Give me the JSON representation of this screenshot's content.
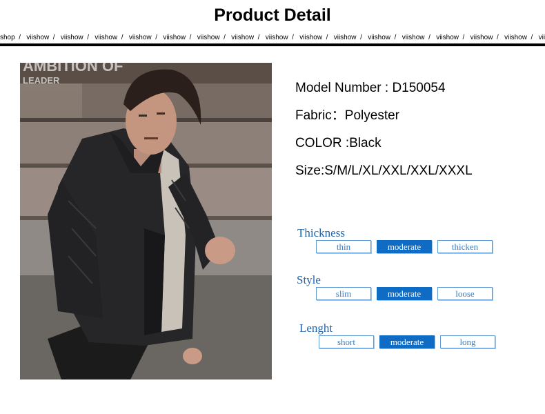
{
  "header": {
    "title": "Product Detail",
    "marquee": [
      "shop",
      "viishow",
      "viishow",
      "viishow",
      "viishow",
      "viishow",
      "viishow",
      "viishow",
      "viishow",
      "viishow",
      "viishow",
      "viishow",
      "viishow",
      "viishow",
      "viishow",
      "viishow",
      "viis"
    ],
    "separator": "/"
  },
  "photo": {
    "sign_text_top": "AMBITION OF",
    "sign_text_bottom": "LEADER"
  },
  "specs": [
    {
      "text": "Model Number : D150054"
    },
    {
      "text": "Fabric：Polyester"
    },
    {
      "text": "COLOR :Black"
    },
    {
      "text": "Size:S/M/L/XL/XXL/XXL/XXXL"
    }
  ],
  "options": [
    {
      "title": "Thickness",
      "items": [
        "thin",
        "moderate",
        "thicken"
      ],
      "selected": 1
    },
    {
      "title": "Style",
      "items": [
        "slim",
        "moderate",
        "loose"
      ],
      "selected": 1
    },
    {
      "title": "Lenght",
      "items": [
        "short",
        "moderate",
        "long"
      ],
      "selected": 1
    }
  ],
  "colors": {
    "accent": "#0f6cc4",
    "accent_text": "#1f63a8"
  }
}
